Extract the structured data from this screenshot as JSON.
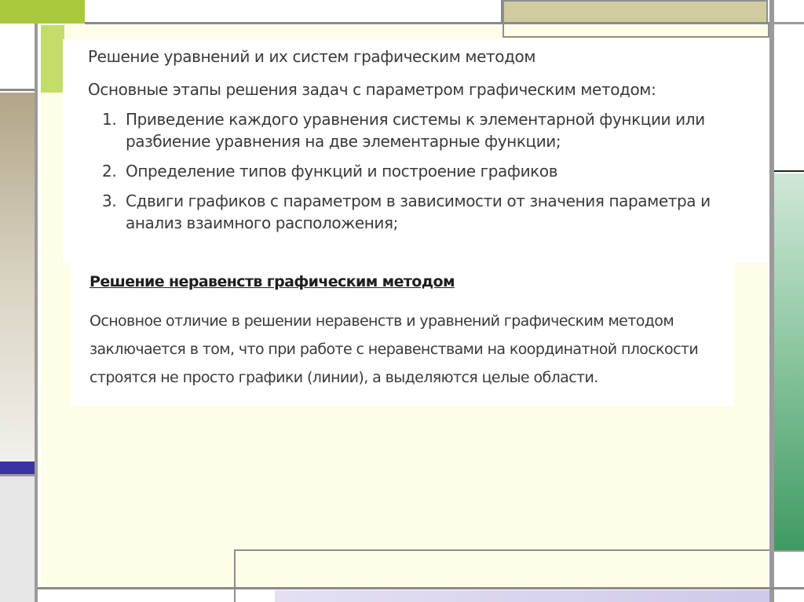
{
  "slide": {
    "title": "Решение уравнений и их систем графическим методом",
    "intro": "Основные этапы решения задач с параметром графическим методом:",
    "steps": [
      {
        "num": "1.",
        "text": "Приведение каждого уравнения системы к элементарной функции или разбиение уравнения на две элементарные функции;"
      },
      {
        "num": "2.",
        "text": "Определение типов функций и построение графиков"
      },
      {
        "num": "3.",
        "text": "Сдвиги графиков с параметром в зависимости от значения параметра и анализ взаимного расположения;"
      }
    ],
    "section2_heading": "Решение неравенств графическим методом",
    "section2_text": "Основное отличие в решении неравенств и уравнений графическим методом заключается в том, что при работе с неравенствами на координатной плоскости строятся не просто графики (линии), а выделяются целые области."
  },
  "colors": {
    "accent_green": "#a9c83c",
    "lime": "#c4dc6a",
    "khaki": "#cfcca0",
    "cream": "#fdfde8",
    "blue": "#3a34a0",
    "right_green": "#3f9a62",
    "text": "#3a3a3a"
  }
}
